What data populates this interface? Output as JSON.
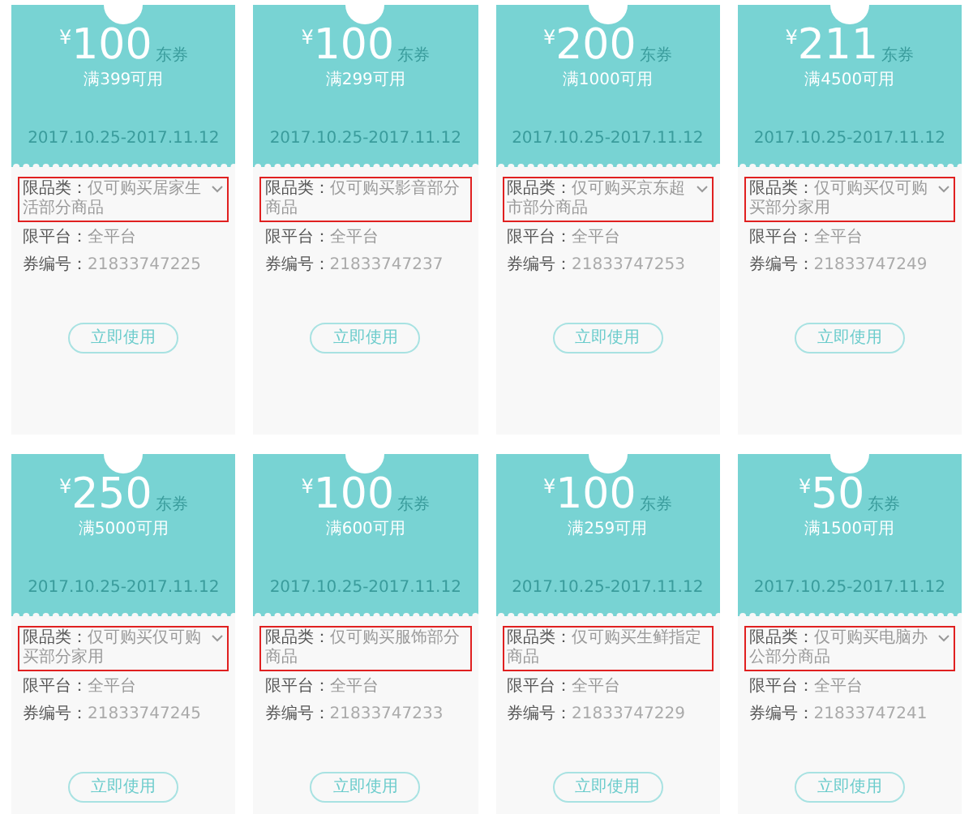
{
  "coupons": [
    {
      "currency": "¥",
      "amount": "100",
      "unit": "东券",
      "condition": "满399可用",
      "validity": "2017.10.25-2017.11.12",
      "category_label": "限品类：",
      "category": "仅可购买居家生活部分商品",
      "has_more": true,
      "highlighted": true,
      "platform_label": "限平台：",
      "platform": "全平台",
      "code_label": "券编号：",
      "code": "21833747225",
      "button": "立即使用"
    },
    {
      "currency": "¥",
      "amount": "100",
      "unit": "东券",
      "condition": "满299可用",
      "validity": "2017.10.25-2017.11.12",
      "category_label": "限品类：",
      "category": "仅可购买影音部分商品",
      "has_more": false,
      "highlighted": true,
      "platform_label": "限平台：",
      "platform": "全平台",
      "code_label": "券编号：",
      "code": "21833747237",
      "button": "立即使用"
    },
    {
      "currency": "¥",
      "amount": "200",
      "unit": "东券",
      "condition": "满1000可用",
      "validity": "2017.10.25-2017.11.12",
      "category_label": "限品类：",
      "category": "仅可购买京东超市部分商品",
      "has_more": true,
      "highlighted": true,
      "platform_label": "限平台：",
      "platform": "全平台",
      "code_label": "券编号：",
      "code": "21833747253",
      "button": "立即使用"
    },
    {
      "currency": "¥",
      "amount": "211",
      "unit": "东券",
      "condition": "满4500可用",
      "validity": "2017.10.25-2017.11.12",
      "category_label": "限品类：",
      "category": "仅可购买仅可购买部分家用",
      "has_more": true,
      "highlighted": true,
      "platform_label": "限平台：",
      "platform": "全平台",
      "code_label": "券编号：",
      "code": "21833747249",
      "button": "立即使用"
    },
    {
      "currency": "¥",
      "amount": "250",
      "unit": "东券",
      "condition": "满5000可用",
      "validity": "2017.10.25-2017.11.12",
      "category_label": "限品类：",
      "category": "仅可购买仅可购买部分家用",
      "has_more": true,
      "highlighted": true,
      "platform_label": "限平台：",
      "platform": "全平台",
      "code_label": "券编号：",
      "code": "21833747245",
      "button": "立即使用"
    },
    {
      "currency": "¥",
      "amount": "100",
      "unit": "东券",
      "condition": "满600可用",
      "validity": "2017.10.25-2017.11.12",
      "category_label": "限品类：",
      "category": "仅可购买服饰部分商品",
      "has_more": false,
      "highlighted": true,
      "platform_label": "限平台：",
      "platform": "全平台",
      "code_label": "券编号：",
      "code": "21833747233",
      "button": "立即使用"
    },
    {
      "currency": "¥",
      "amount": "100",
      "unit": "东券",
      "condition": "满259可用",
      "validity": "2017.10.25-2017.11.12",
      "category_label": "限品类：",
      "category": "仅可购买生鲜指定商品",
      "has_more": false,
      "highlighted": true,
      "platform_label": "限平台：",
      "platform": "全平台",
      "code_label": "券编号：",
      "code": "21833747229",
      "button": "立即使用"
    },
    {
      "currency": "¥",
      "amount": "50",
      "unit": "东券",
      "condition": "满1500可用",
      "validity": "2017.10.25-2017.11.12",
      "category_label": "限品类：",
      "category": "仅可购买电脑办公部分商品",
      "has_more": true,
      "highlighted": true,
      "platform_label": "限平台：",
      "platform": "全平台",
      "code_label": "券编号：",
      "code": "21833747241",
      "button": "立即使用"
    }
  ]
}
